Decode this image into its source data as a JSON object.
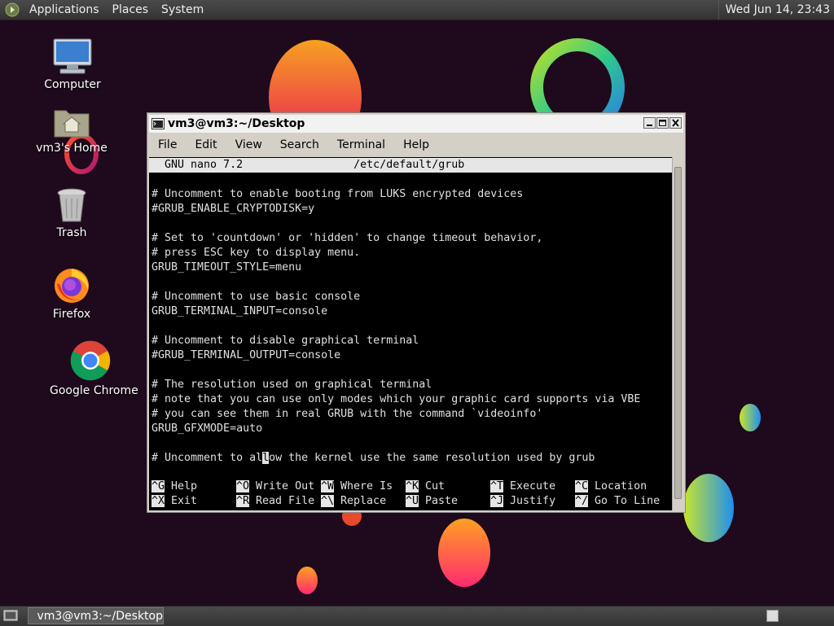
{
  "top_panel": {
    "menus": [
      "Applications",
      "Places",
      "System"
    ],
    "clock": "Wed Jun 14, 23:43"
  },
  "desktop_icons": [
    {
      "label": "Computer",
      "icon": "computer-icon"
    },
    {
      "label": "vm3's Home",
      "icon": "home-folder-icon"
    },
    {
      "label": "Trash",
      "icon": "trash-icon"
    },
    {
      "label": "Firefox",
      "icon": "firefox-icon"
    },
    {
      "label": "Google Chrome",
      "icon": "chrome-icon"
    }
  ],
  "window": {
    "title": "vm3@vm3:~/Desktop",
    "menu": [
      "File",
      "Edit",
      "View",
      "Search",
      "Terminal",
      "Help"
    ]
  },
  "nano": {
    "header": "  GNU nano 7.2                 /etc/default/grub",
    "lines": [
      "",
      "# Uncomment to enable booting from LUKS encrypted devices",
      "#GRUB_ENABLE_CRYPTODISK=y",
      "",
      "# Set to 'countdown' or 'hidden' to change timeout behavior,",
      "# press ESC key to display menu.",
      "GRUB_TIMEOUT_STYLE=menu",
      "",
      "# Uncomment to use basic console",
      "GRUB_TERMINAL_INPUT=console",
      "",
      "# Uncomment to disable graphical terminal",
      "#GRUB_TERMINAL_OUTPUT=console",
      "",
      "# The resolution used on graphical terminal",
      "# note that you can use only modes which your graphic card supports via VBE",
      "# you can see them in real GRUB with the command `videoinfo'",
      "GRUB_GFXMODE=auto",
      "",
      "# Uncomment to allow the kernel use the same resolution used by grub"
    ],
    "cursor": {
      "line": 19,
      "col": 17
    },
    "shortcuts": [
      [
        {
          "key": "^G",
          "label": "Help"
        },
        {
          "key": "^O",
          "label": "Write Out"
        },
        {
          "key": "^W",
          "label": "Where Is"
        },
        {
          "key": "^K",
          "label": "Cut"
        },
        {
          "key": "^T",
          "label": "Execute"
        },
        {
          "key": "^C",
          "label": "Location"
        }
      ],
      [
        {
          "key": "^X",
          "label": "Exit"
        },
        {
          "key": "^R",
          "label": "Read File"
        },
        {
          "key": "^\\",
          "label": "Replace"
        },
        {
          "key": "^U",
          "label": "Paste"
        },
        {
          "key": "^J",
          "label": "Justify"
        },
        {
          "key": "^/",
          "label": "Go To Line"
        }
      ]
    ]
  },
  "taskbar": {
    "task_label": "vm3@vm3:~/Desktop"
  },
  "colors": {
    "terminal_bg": "#000000",
    "terminal_fg": "#e0e0e0",
    "nano_bar": "#e6e6e6",
    "panel": "#3d3d3d"
  }
}
